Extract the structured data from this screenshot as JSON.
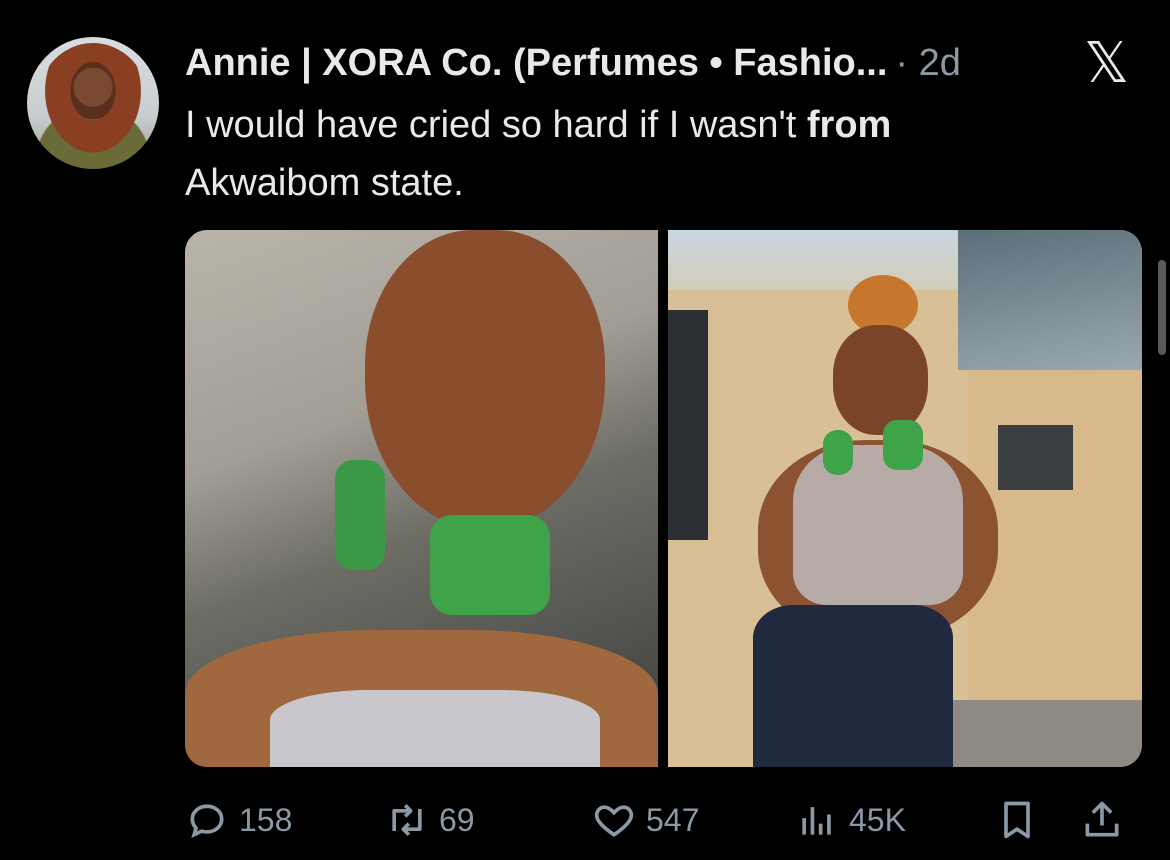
{
  "tweet": {
    "author": "Annie | XORA Co. (Perfumes • Fashio...",
    "time": "· 2d",
    "text_before": "I would have cried so hard if I wasn't ",
    "text_bold": "from",
    "text_after": " Akwaibom state.",
    "logo": "x-logo"
  },
  "actions": {
    "replies": "158",
    "retweets": "69",
    "likes": "547",
    "views": "45K"
  },
  "icons": [
    "reply-icon",
    "retweet-icon",
    "heart-icon",
    "views-icon",
    "bookmark-icon",
    "share-icon"
  ],
  "colors": {
    "background": "#000000",
    "text": "#e7e9ea",
    "muted": "#8b98a5"
  }
}
